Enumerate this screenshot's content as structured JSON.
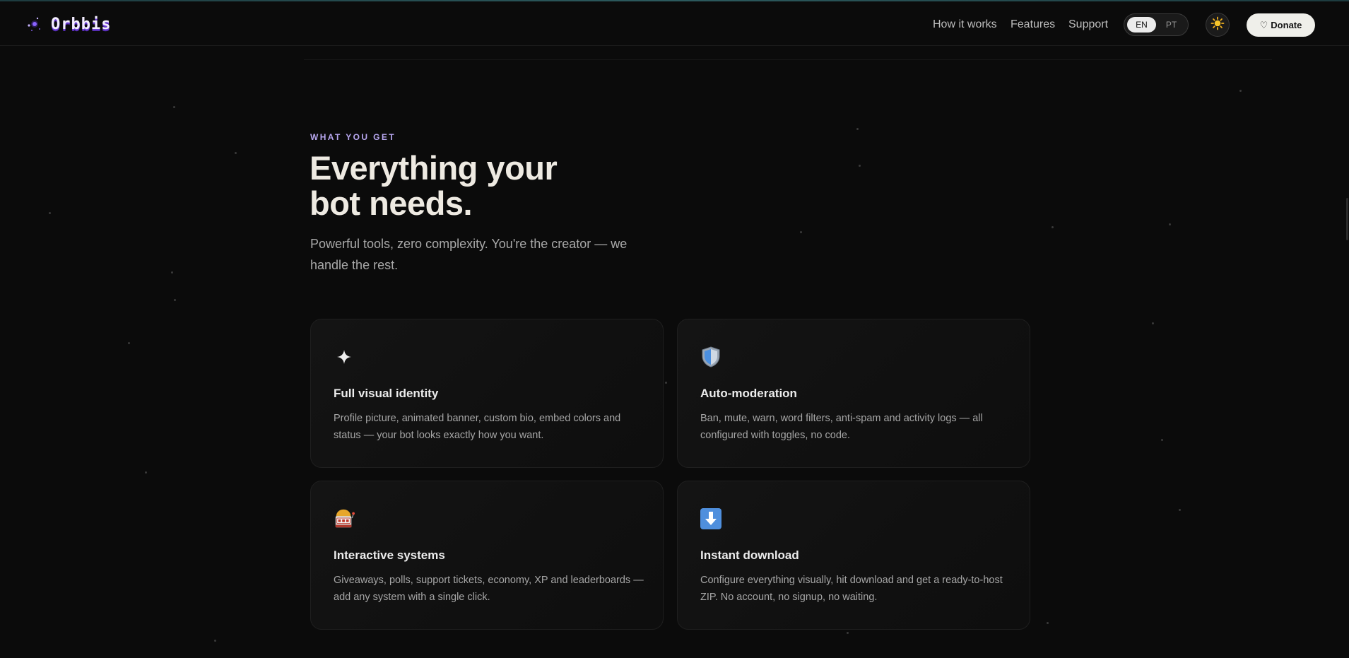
{
  "header": {
    "brand_name": "Orbbis",
    "nav": [
      "How it works",
      "Features",
      "Support"
    ],
    "lang": {
      "active": "EN",
      "other": "PT"
    },
    "donate_label": "Donate",
    "donate_icon": "heart-outline-icon",
    "theme_icon": "sun-icon"
  },
  "hero": {
    "eyebrow": "WHAT YOU GET",
    "headline_line1": "Everything your",
    "headline_line2": "bot needs.",
    "subhead": "Powerful tools, zero complexity. You're the creator — we handle the rest."
  },
  "features": [
    {
      "icon": "sparkle-icon",
      "title": "Full visual identity",
      "description": "Profile picture, animated banner, custom bio, embed colors and status — your bot looks exactly how you want."
    },
    {
      "icon": "shield-icon",
      "title": "Auto-moderation",
      "description": "Ban, mute, warn, word filters, anti-spam and activity logs — all configured with toggles, no code."
    },
    {
      "icon": "slot-machine-icon",
      "title": "Interactive systems",
      "description": "Giveaways, polls, support tickets, economy, XP and leaderboards — add any system with a single click."
    },
    {
      "icon": "download-arrow-icon",
      "title": "Instant download",
      "description": "Configure everything visually, hit download and get a ready-to-host ZIP. No account, no signup, no waiting."
    }
  ],
  "colors": {
    "background": "#0b0b0b",
    "accent": "#b8a7f0",
    "brand_purple": "#6d3fd6",
    "donate_bg": "#efefea"
  }
}
